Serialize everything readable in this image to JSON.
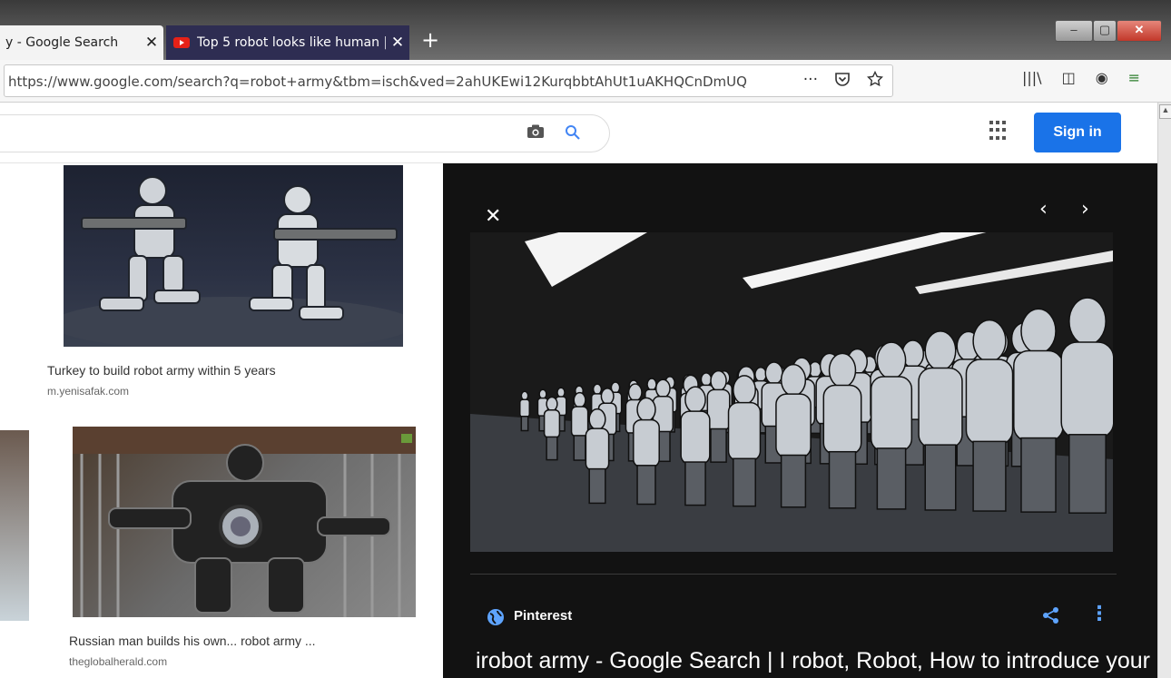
{
  "browser": {
    "tabs": [
      {
        "label": "y - Google Search",
        "active": true
      },
      {
        "label": "Top 5 robot looks like human |",
        "active": false
      }
    ],
    "url": "https://www.google.com/search?q=robot+army&tbm=isch&ved=2ahUKEwi12KurqbbtAhUt1uAKHQCnDmUQ",
    "new_tab_symbol": "+",
    "tab_close_symbol": "✕",
    "page_actions_symbol": "···",
    "window_controls": {
      "minimize": "–",
      "maximize": "▢",
      "close": "✕"
    },
    "toolbar_symbols": {
      "library": "|||\\",
      "sidebar": "◫",
      "account": "◉",
      "menu": "≡"
    }
  },
  "google_header": {
    "signin_label": "Sign in"
  },
  "results": [
    {
      "title": "Turkey to build robot army within 5 years",
      "source": "m.yenisafak.com"
    },
    {
      "title": "Russian man builds his own... robot army ...",
      "source": "theglobalherald.com"
    }
  ],
  "preview": {
    "close_symbol": "✕",
    "prev_symbol": "‹",
    "next_symbol": "›",
    "source": "Pinterest",
    "title": "irobot army - Google Search | I robot, Robot, How to introduce your",
    "more_symbol": "⋮"
  },
  "colors": {
    "signin_button": "#1a73e8",
    "preview_bg": "#121212",
    "accent_blue": "#5ea4ff",
    "youtube_red": "#e62117"
  },
  "icons": [
    "camera-icon",
    "search-icon",
    "apps-icon",
    "pocket-icon",
    "star-icon",
    "globe-icon",
    "share-icon",
    "more-icon",
    "youtube-icon"
  ]
}
